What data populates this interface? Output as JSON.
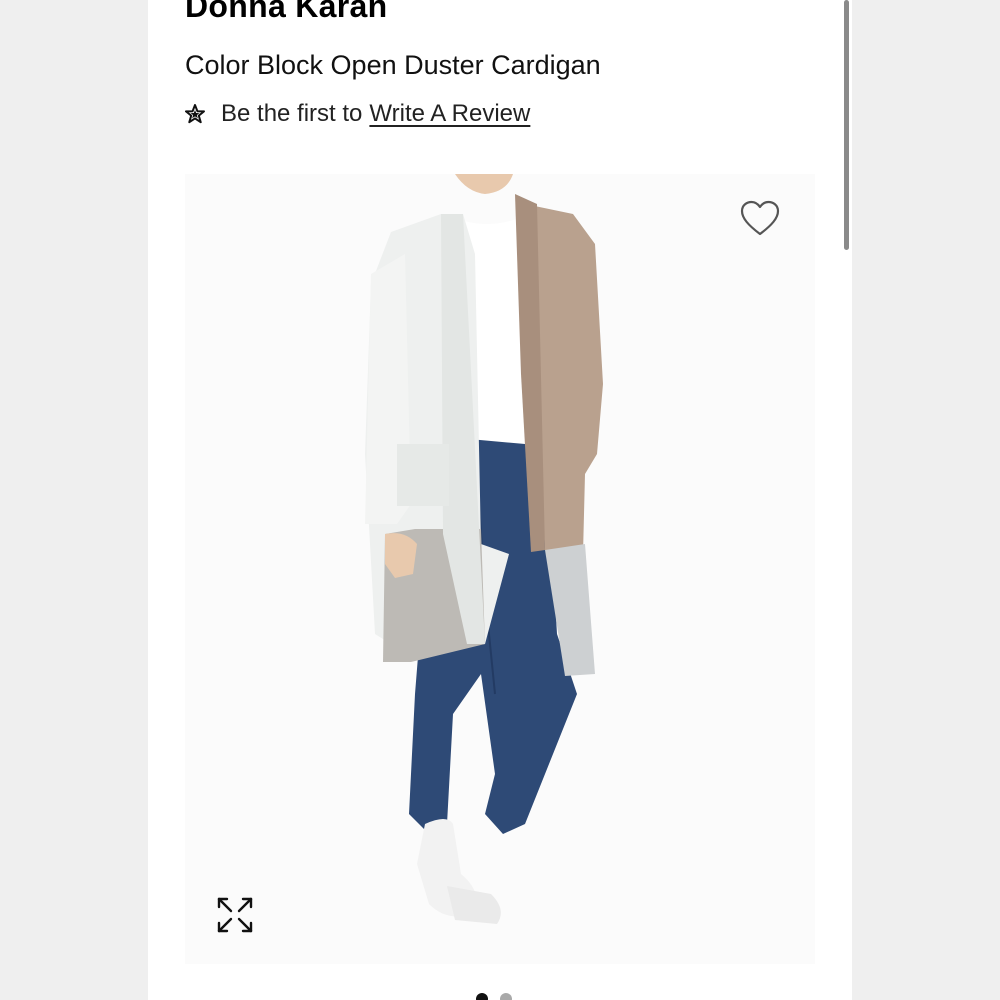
{
  "product": {
    "brand": "Donna Karan",
    "name": "Color Block Open Duster Cardigan"
  },
  "reviews": {
    "prefix": "Be the first to",
    "link_label": "Write A Review"
  },
  "image": {
    "alt": "Color Block Open Duster Cardigan product photo"
  },
  "carousel": {
    "total_slides": 2,
    "active_index": 0
  },
  "colors": {
    "cardigan_white": "#eef0ef",
    "cardigan_taupe": "#b9a18e",
    "cardigan_grey": "#bdbab5",
    "denim": "#2e4a76",
    "accent_text": "#111111"
  },
  "icons": {
    "star": "star-icon",
    "heart": "heart-icon",
    "expand": "expand-icon"
  }
}
